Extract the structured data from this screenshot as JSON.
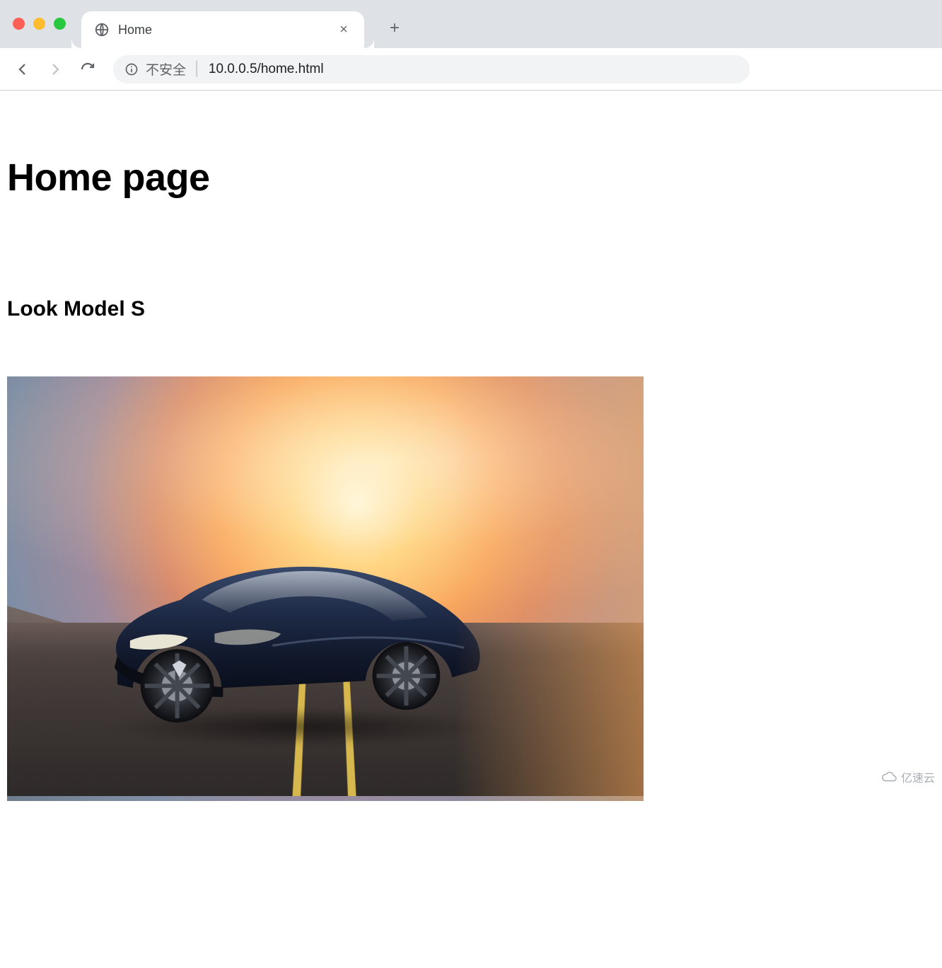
{
  "browser": {
    "tab": {
      "title": "Home",
      "favicon": "globe-icon"
    },
    "toolbar": {
      "back": "←",
      "forward": "→",
      "reload": "⟳",
      "security_label": "不安全",
      "url": "10.0.0.5/home.html"
    }
  },
  "page": {
    "heading": "Home page",
    "subheading": "Look Model S",
    "hero_alt": "Dark blue sedan driving on a highway at sunset"
  },
  "watermark": {
    "text": "亿速云"
  }
}
